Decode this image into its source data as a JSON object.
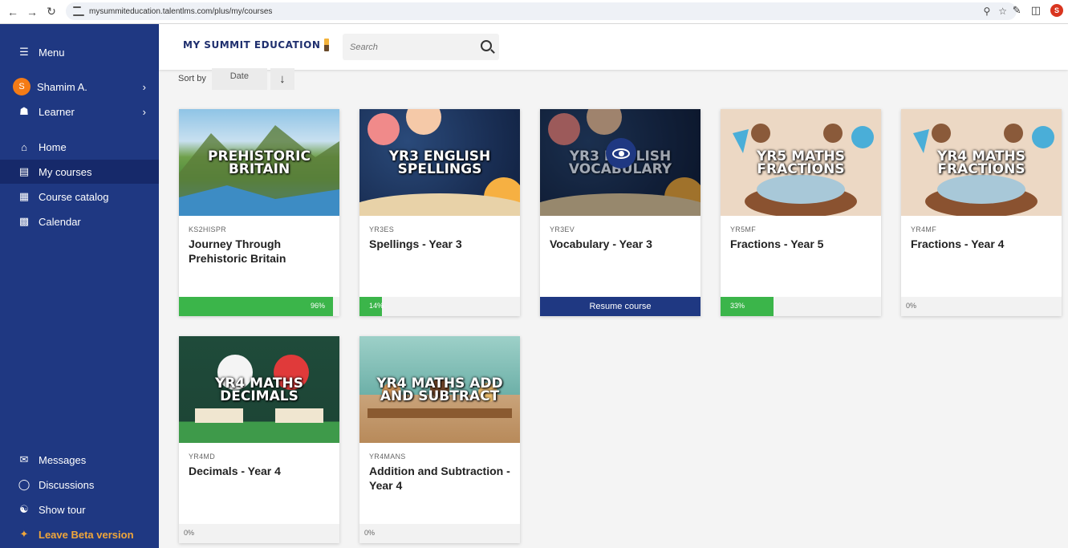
{
  "browser": {
    "url": "mysummiteducation.talentlms.com/plus/my/courses",
    "profile_initial": "S"
  },
  "sidebar": {
    "menu_label": "Menu",
    "user_name": "Shamim A.",
    "user_initial": "S",
    "role": "Learner",
    "items": [
      {
        "label": "Home",
        "icon": "home-icon"
      },
      {
        "label": "My courses",
        "icon": "book-icon"
      },
      {
        "label": "Course catalog",
        "icon": "catalog-icon"
      },
      {
        "label": "Calendar",
        "icon": "calendar-icon"
      }
    ],
    "bottom": [
      {
        "label": "Messages",
        "icon": "messages-icon"
      },
      {
        "label": "Discussions",
        "icon": "discussions-icon"
      },
      {
        "label": "Show tour",
        "icon": "tour-icon"
      },
      {
        "label": "Leave Beta version",
        "icon": "beta-icon"
      }
    ],
    "colors": {
      "background": "#1f3882",
      "active": "#16296a",
      "beta": "#f0a63a"
    }
  },
  "header": {
    "logo_text": "MY SUMMIT EDUCATION",
    "search_placeholder": "Search"
  },
  "sort": {
    "label": "Sort by",
    "value": "Date"
  },
  "courses": [
    {
      "code": "KS2HISPR",
      "title": "Journey Through Prehistoric Britain",
      "thumb_title": "PREHISTORIC BRITAIN",
      "progress": 96,
      "progress_label": "96%"
    },
    {
      "code": "YR3ES",
      "title": "Spellings - Year 3",
      "thumb_title": "YR3 ENGLISH SPELLINGS",
      "progress": 14,
      "progress_label": "14%"
    },
    {
      "code": "YR3EV",
      "title": "Vocabulary - Year 3",
      "thumb_title": "YR3 ENGLISH VOCABULARY",
      "action_label": "Resume course"
    },
    {
      "code": "YR5MF",
      "title": "Fractions - Year 5",
      "thumb_title": "YR5 MATHS FRACTIONS",
      "progress": 33,
      "progress_label": "33%"
    },
    {
      "code": "YR4MF",
      "title": "Fractions - Year 4",
      "thumb_title": "YR4 MATHS FRACTIONS",
      "progress": 0,
      "progress_label": "0%"
    },
    {
      "code": "YR4MD",
      "title": "Decimals - Year 4",
      "thumb_title": "YR4 MATHS DECIMALS",
      "progress": 0,
      "progress_label": "0%"
    },
    {
      "code": "YR4MANS",
      "title": "Addition and Subtraction - Year 4",
      "thumb_title": "YR4 MATHS ADD AND SUBTRACT",
      "progress": 0,
      "progress_label": "0%"
    }
  ],
  "colors": {
    "progress_fill": "#3bb54a",
    "resume": "#1f3882"
  }
}
